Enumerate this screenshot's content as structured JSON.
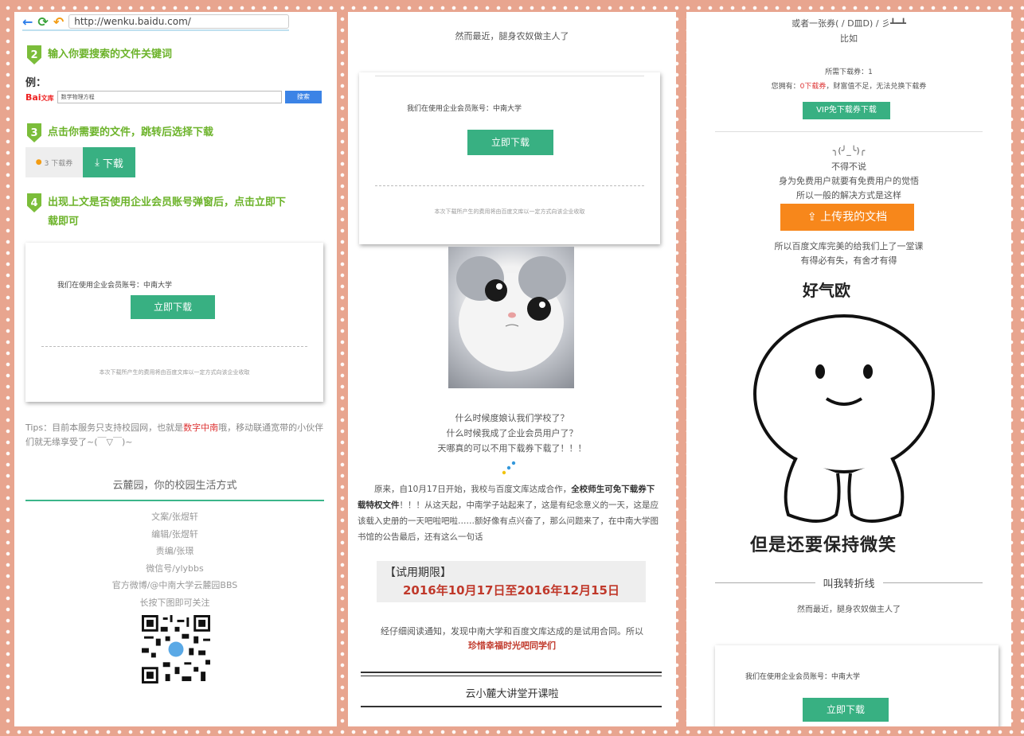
{
  "panel1": {
    "url": "http://wenku.baidu.com/",
    "steps": [
      {
        "num": "2",
        "text": "输入你要搜索的文件关键词"
      },
      {
        "num": "3",
        "text": "点击你需要的文件，跳转后选择下载"
      },
      {
        "num": "4",
        "text_line1": "出现上文是否使用企业会员账号弹窗后，点击立即下",
        "text_line2": "载即可"
      }
    ],
    "example_label": "例：",
    "baidu_logo": "Bai",
    "baidu_logo_suffix": "文库",
    "search_placeholder": "数学物理方程",
    "search_btn": "搜索",
    "download_count": "3 下载券",
    "download_btn": "下载",
    "dialog": {
      "message": "我们在使用企业会员账号：中南大学",
      "button": "立即下载",
      "note": "本次下载所产生的费用将由百度文库以一定方式向该企业收取"
    },
    "tips_prefix": "Tips：目前本服务只支持校园网，也就是",
    "tips_highlight": "数字中南",
    "tips_suffix": "哦，移动联通宽带的小伙伴们就无缘享受了~(￣▽￣)~",
    "slogan": "云麓园，你的校园生活方式",
    "credits": [
      "文案/张煜轩",
      "编辑/张煜轩",
      "责编/张璟",
      "微信号/ylybbs",
      "官方微博/@中南大学云麓园BBS",
      "长按下图即可关注"
    ]
  },
  "panel2": {
    "top_line": "然而最近，腿身农奴做主人了",
    "dialog": {
      "message": "我们在使用企业会员账号：中南大学",
      "button": "立即下载",
      "note": "本次下载所产生的费用将由百度文库以一定方式向该企业收取"
    },
    "questions": [
      "什么时候度娘认我们学校了？",
      "什么时候我成了企业会员用户了？",
      "天哪真的可以不用下载券下载了！！！"
    ],
    "para_start": "原来，自10月17日开始，我校与百度文库达成合作，",
    "para_bold": "全校师生可免下载券下载特权文件",
    "para_rest": "！！！从这天起，中南学子站起来了，这是有纪念意义的一天，这是应该载入史册的一天吧啦吧啦……额好像有点兴奋了，那么问题来了，在中南大学图书馆的公告最后，还有这么一句话",
    "trial_label": "【试用期限】",
    "trial_dates": "2016年10月17日至2016年12月15日",
    "closing_line": "经仔细阅读通知，发现中南大学和百度文库达成的是试用合同。所以",
    "closing_red": "珍惜幸福时光吧同学们",
    "lecture": "云小麓大讲堂开课啦"
  },
  "panel3": {
    "top1": "或者一张券( / D皿D) / 彡┻━┻",
    "top2": "比如",
    "need_label": "所需下载券：1",
    "own_prefix": "您拥有：",
    "own_value": "0下载券",
    "own_suffix": "，财富值不足，无法兑换下载券",
    "vip_btn": "VIP免下载券下载",
    "shrug": "╮(╯_╰)╭",
    "t1": "不得不说",
    "t2": "身为免费用户就要有免费用户的觉悟",
    "t3": "所以一般的解决方式是这样",
    "upload_btn": "上传我的文档",
    "t4": "所以百度文库完美的给我们上了一堂课",
    "t5": "有得必有失，有舍才有得",
    "meme_top": "好气欧",
    "meme_bottom": "但是还要保持微笑",
    "divider": "叫我转折线",
    "divider_sub": "然而最近，腿身农奴做主人了",
    "dialog_message": "我们在使用企业会员账号：中南大学",
    "dialog_button": "立即下载"
  },
  "colors": {
    "frame": "#e8a58f",
    "green": "#38b082",
    "step_green": "#6cb32a",
    "orange": "#f7871b",
    "red": "#c0392b"
  }
}
